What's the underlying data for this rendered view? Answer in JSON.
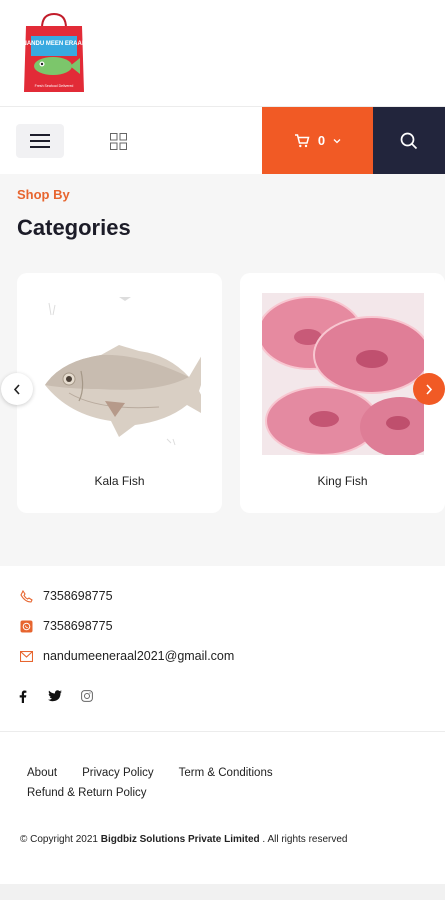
{
  "brand": {
    "logo_text": "NANDU MEEN ERAAL",
    "logo_tagline": "Fresh Seafood Delivered"
  },
  "nav": {
    "cart_count": "0"
  },
  "categories": {
    "eyebrow": "Shop By",
    "title": "Categories",
    "items": [
      {
        "name": "Kala Fish"
      },
      {
        "name": "King Fish"
      }
    ]
  },
  "contact": {
    "phone": "7358698775",
    "whatsapp": "7358698775",
    "email": "nandumeeneraal2021@gmail.com"
  },
  "footer": {
    "links": [
      "About",
      "Privacy Policy",
      "Term & Conditions",
      "Refund & Return Policy"
    ],
    "copyright_prefix": "© Copyright 2021 ",
    "company": "Bigdbiz Solutions Private Limited",
    "copyright_suffix": " . All rights reserved"
  },
  "colors": {
    "accent": "#f15a25",
    "dark": "#22253c"
  }
}
